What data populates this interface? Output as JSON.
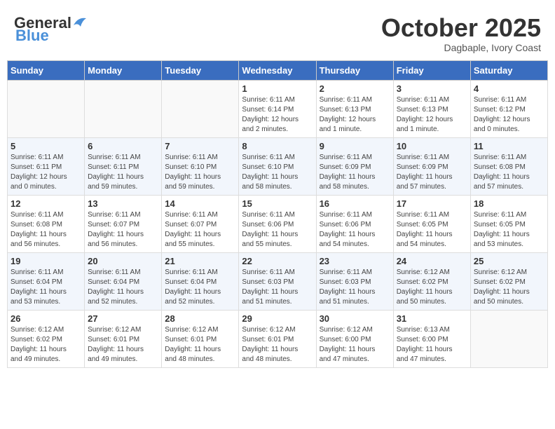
{
  "header": {
    "logo_general": "General",
    "logo_blue": "Blue",
    "month": "October 2025",
    "location": "Dagbaple, Ivory Coast"
  },
  "weekdays": [
    "Sunday",
    "Monday",
    "Tuesday",
    "Wednesday",
    "Thursday",
    "Friday",
    "Saturday"
  ],
  "weeks": [
    [
      {
        "day": "",
        "info": ""
      },
      {
        "day": "",
        "info": ""
      },
      {
        "day": "",
        "info": ""
      },
      {
        "day": "1",
        "info": "Sunrise: 6:11 AM\nSunset: 6:14 PM\nDaylight: 12 hours\nand 2 minutes."
      },
      {
        "day": "2",
        "info": "Sunrise: 6:11 AM\nSunset: 6:13 PM\nDaylight: 12 hours\nand 1 minute."
      },
      {
        "day": "3",
        "info": "Sunrise: 6:11 AM\nSunset: 6:13 PM\nDaylight: 12 hours\nand 1 minute."
      },
      {
        "day": "4",
        "info": "Sunrise: 6:11 AM\nSunset: 6:12 PM\nDaylight: 12 hours\nand 0 minutes."
      }
    ],
    [
      {
        "day": "5",
        "info": "Sunrise: 6:11 AM\nSunset: 6:11 PM\nDaylight: 12 hours\nand 0 minutes."
      },
      {
        "day": "6",
        "info": "Sunrise: 6:11 AM\nSunset: 6:11 PM\nDaylight: 11 hours\nand 59 minutes."
      },
      {
        "day": "7",
        "info": "Sunrise: 6:11 AM\nSunset: 6:10 PM\nDaylight: 11 hours\nand 59 minutes."
      },
      {
        "day": "8",
        "info": "Sunrise: 6:11 AM\nSunset: 6:10 PM\nDaylight: 11 hours\nand 58 minutes."
      },
      {
        "day": "9",
        "info": "Sunrise: 6:11 AM\nSunset: 6:09 PM\nDaylight: 11 hours\nand 58 minutes."
      },
      {
        "day": "10",
        "info": "Sunrise: 6:11 AM\nSunset: 6:09 PM\nDaylight: 11 hours\nand 57 minutes."
      },
      {
        "day": "11",
        "info": "Sunrise: 6:11 AM\nSunset: 6:08 PM\nDaylight: 11 hours\nand 57 minutes."
      }
    ],
    [
      {
        "day": "12",
        "info": "Sunrise: 6:11 AM\nSunset: 6:08 PM\nDaylight: 11 hours\nand 56 minutes."
      },
      {
        "day": "13",
        "info": "Sunrise: 6:11 AM\nSunset: 6:07 PM\nDaylight: 11 hours\nand 56 minutes."
      },
      {
        "day": "14",
        "info": "Sunrise: 6:11 AM\nSunset: 6:07 PM\nDaylight: 11 hours\nand 55 minutes."
      },
      {
        "day": "15",
        "info": "Sunrise: 6:11 AM\nSunset: 6:06 PM\nDaylight: 11 hours\nand 55 minutes."
      },
      {
        "day": "16",
        "info": "Sunrise: 6:11 AM\nSunset: 6:06 PM\nDaylight: 11 hours\nand 54 minutes."
      },
      {
        "day": "17",
        "info": "Sunrise: 6:11 AM\nSunset: 6:05 PM\nDaylight: 11 hours\nand 54 minutes."
      },
      {
        "day": "18",
        "info": "Sunrise: 6:11 AM\nSunset: 6:05 PM\nDaylight: 11 hours\nand 53 minutes."
      }
    ],
    [
      {
        "day": "19",
        "info": "Sunrise: 6:11 AM\nSunset: 6:04 PM\nDaylight: 11 hours\nand 53 minutes."
      },
      {
        "day": "20",
        "info": "Sunrise: 6:11 AM\nSunset: 6:04 PM\nDaylight: 11 hours\nand 52 minutes."
      },
      {
        "day": "21",
        "info": "Sunrise: 6:11 AM\nSunset: 6:04 PM\nDaylight: 11 hours\nand 52 minutes."
      },
      {
        "day": "22",
        "info": "Sunrise: 6:11 AM\nSunset: 6:03 PM\nDaylight: 11 hours\nand 51 minutes."
      },
      {
        "day": "23",
        "info": "Sunrise: 6:11 AM\nSunset: 6:03 PM\nDaylight: 11 hours\nand 51 minutes."
      },
      {
        "day": "24",
        "info": "Sunrise: 6:12 AM\nSunset: 6:02 PM\nDaylight: 11 hours\nand 50 minutes."
      },
      {
        "day": "25",
        "info": "Sunrise: 6:12 AM\nSunset: 6:02 PM\nDaylight: 11 hours\nand 50 minutes."
      }
    ],
    [
      {
        "day": "26",
        "info": "Sunrise: 6:12 AM\nSunset: 6:02 PM\nDaylight: 11 hours\nand 49 minutes."
      },
      {
        "day": "27",
        "info": "Sunrise: 6:12 AM\nSunset: 6:01 PM\nDaylight: 11 hours\nand 49 minutes."
      },
      {
        "day": "28",
        "info": "Sunrise: 6:12 AM\nSunset: 6:01 PM\nDaylight: 11 hours\nand 48 minutes."
      },
      {
        "day": "29",
        "info": "Sunrise: 6:12 AM\nSunset: 6:01 PM\nDaylight: 11 hours\nand 48 minutes."
      },
      {
        "day": "30",
        "info": "Sunrise: 6:12 AM\nSunset: 6:00 PM\nDaylight: 11 hours\nand 47 minutes."
      },
      {
        "day": "31",
        "info": "Sunrise: 6:13 AM\nSunset: 6:00 PM\nDaylight: 11 hours\nand 47 minutes."
      },
      {
        "day": "",
        "info": ""
      }
    ]
  ]
}
